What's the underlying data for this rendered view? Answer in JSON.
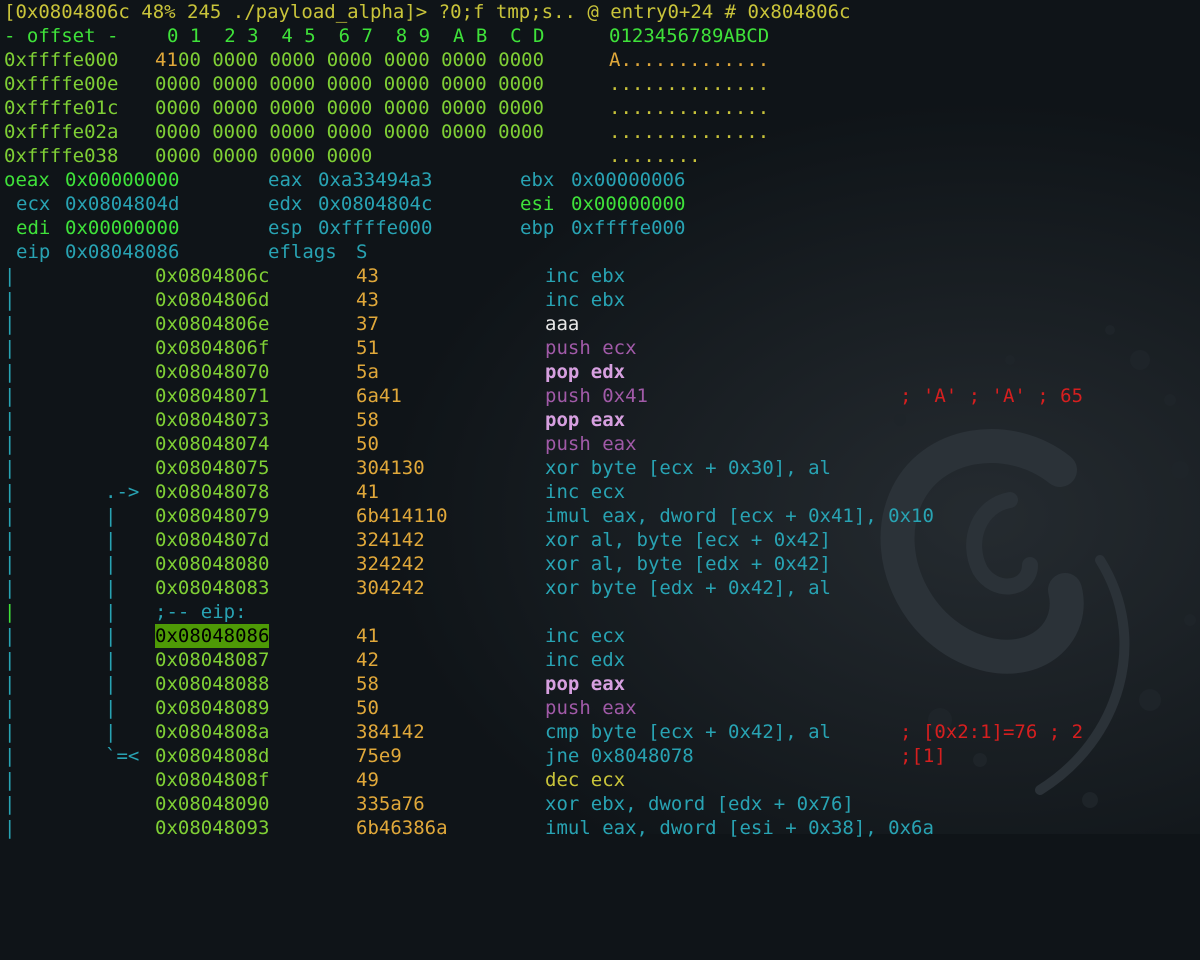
{
  "prompt": "[0x0804806c 48% 245 ./payload_alpha]> ?0;f tmp;s.. @ entry0+24 # 0x804806c",
  "hex": {
    "header": {
      "offset": "- offset -",
      "cols": "0 1  2 3  4 5  6 7  8 9  A B  C D",
      "ascii": "0123456789ABCD"
    },
    "rows": [
      {
        "addr": "0xffffe000",
        "b0": "41",
        "rest": "00 0000 0000 0000 0000 0000 0000",
        "ascii": "A............."
      },
      {
        "addr": "0xffffe00e",
        "b0": "",
        "rest": "0000 0000 0000 0000 0000 0000 0000",
        "ascii": ".............."
      },
      {
        "addr": "0xffffe01c",
        "b0": "",
        "rest": "0000 0000 0000 0000 0000 0000 0000",
        "ascii": ".............."
      },
      {
        "addr": "0xffffe02a",
        "b0": "",
        "rest": "0000 0000 0000 0000 0000 0000 0000",
        "ascii": ".............."
      },
      {
        "addr": "0xffffe038",
        "b0": "",
        "rest": "0000 0000 0000 0000",
        "ascii": "........"
      }
    ]
  },
  "registers": {
    "oeax": {
      "name": "oeax",
      "value": "0x00000000"
    },
    "eax": {
      "name": "eax",
      "value": "0xa33494a3"
    },
    "ebx": {
      "name": "ebx",
      "value": "0x00000006"
    },
    "ecx": {
      "name": "ecx",
      "value": "0x0804804d"
    },
    "edx": {
      "name": "edx",
      "value": "0x0804804c"
    },
    "esi": {
      "name": "esi",
      "value": "0x00000000"
    },
    "edi": {
      "name": "edi",
      "value": "0x00000000"
    },
    "esp": {
      "name": "esp",
      "value": "0xffffe000"
    },
    "ebp": {
      "name": "ebp",
      "value": "0xffffe000"
    },
    "eip": {
      "name": "eip",
      "value": "0x08048086"
    },
    "eflags": {
      "name": "eflags",
      "value": "S"
    }
  },
  "disasm": [
    {
      "flow": "",
      "addr": "0x0804806c",
      "bytes": "43",
      "op": "inc ebx",
      "comment": ""
    },
    {
      "flow": "",
      "addr": "0x0804806d",
      "bytes": "43",
      "op": "inc ebx",
      "comment": ""
    },
    {
      "flow": "",
      "addr": "0x0804806e",
      "bytes": "37",
      "op": "aaa",
      "comment": ""
    },
    {
      "flow": "",
      "addr": "0x0804806f",
      "bytes": "51",
      "op": "push ecx",
      "comment": ""
    },
    {
      "flow": "",
      "addr": "0x08048070",
      "bytes": "5a",
      "op": "pop edx",
      "comment": ""
    },
    {
      "flow": "",
      "addr": "0x08048071",
      "bytes": "6a41",
      "op": "push 0x41",
      "comment": "; 'A' ; 'A' ; 65"
    },
    {
      "flow": "",
      "addr": "0x08048073",
      "bytes": "58",
      "op": "pop eax",
      "comment": ""
    },
    {
      "flow": "",
      "addr": "0x08048074",
      "bytes": "50",
      "op": "push eax",
      "comment": ""
    },
    {
      "flow": "",
      "addr": "0x08048075",
      "bytes": "304130",
      "op": "xor byte [ecx + 0x30], al",
      "comment": ""
    },
    {
      "flow": ".->",
      "addr": "0x08048078",
      "bytes": "41",
      "op": "inc ecx",
      "comment": ""
    },
    {
      "flow": "|",
      "addr": "0x08048079",
      "bytes": "6b414110",
      "op": "imul eax, dword [ecx + 0x41], 0x10",
      "comment": ""
    },
    {
      "flow": "|",
      "addr": "0x0804807d",
      "bytes": "324142",
      "op": "xor al, byte [ecx + 0x42]",
      "comment": ""
    },
    {
      "flow": "|",
      "addr": "0x08048080",
      "bytes": "324242",
      "op": "xor al, byte [edx + 0x42]",
      "comment": ""
    },
    {
      "flow": "|",
      "addr": "0x08048083",
      "bytes": "304242",
      "op": "xor byte [edx + 0x42], al",
      "comment": ""
    },
    {
      "flow": "|",
      "label": ";-- eip:"
    },
    {
      "flow": "|",
      "addr": "0x08048086",
      "bytes": "41",
      "op": "inc ecx",
      "comment": ""
    },
    {
      "flow": "|",
      "addr": "0x08048087",
      "bytes": "42",
      "op": "inc edx",
      "comment": ""
    },
    {
      "flow": "|",
      "addr": "0x08048088",
      "bytes": "58",
      "op": "pop eax",
      "comment": ""
    },
    {
      "flow": "|",
      "addr": "0x08048089",
      "bytes": "50",
      "op": "push eax",
      "comment": ""
    },
    {
      "flow": "|",
      "addr": "0x0804808a",
      "bytes": "384142",
      "op": "cmp byte [ecx + 0x42], al",
      "comment": "; [0x2:1]=76 ; 2"
    },
    {
      "flow": "`=<",
      "addr": "0x0804808d",
      "bytes": "75e9",
      "op": "jne 0x8048078",
      "comment": ";[1]"
    },
    {
      "flow": "",
      "addr": "0x0804808f",
      "bytes": "49",
      "op": "dec ecx",
      "comment": ""
    },
    {
      "flow": "",
      "addr": "0x08048090",
      "bytes": "335a76",
      "op": "xor ebx, dword [edx + 0x76]",
      "comment": ""
    },
    {
      "flow": "",
      "addr": "0x08048093",
      "bytes": "6b46386a",
      "op": "imul eax, dword [esi + 0x38], 0x6a",
      "comment": ""
    }
  ],
  "left_gutter": "|"
}
